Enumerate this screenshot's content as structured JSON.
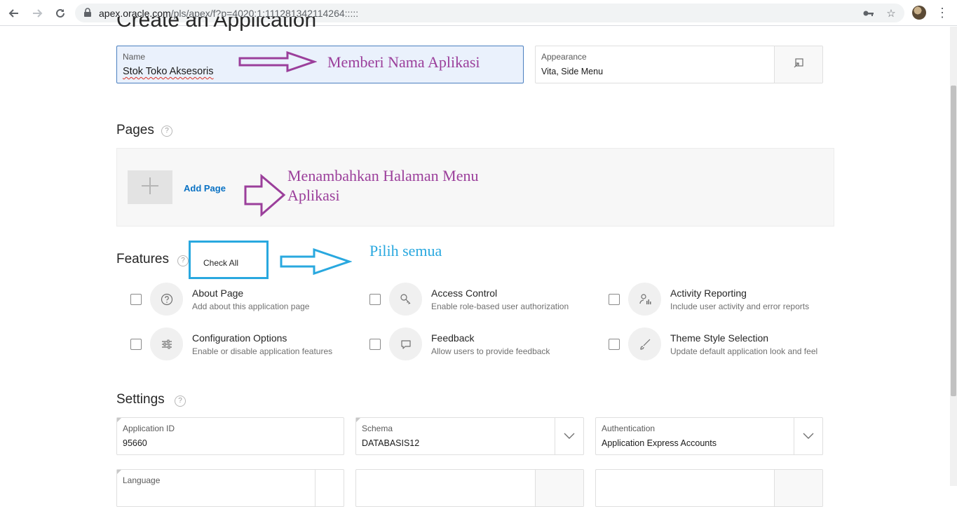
{
  "browser": {
    "url_host": "apex.oracle.com",
    "url_path": "/pls/apex/f?p=4020:1:111281342114264:::::"
  },
  "page": {
    "title": "Create an Application"
  },
  "name_field": {
    "label": "Name",
    "value": "Stok Toko Aksesoris"
  },
  "appearance_field": {
    "label": "Appearance",
    "value": "Vita, Side Menu"
  },
  "pages": {
    "title": "Pages",
    "add_page": "Add Page"
  },
  "features": {
    "title": "Features",
    "check_all": "Check All",
    "items": [
      {
        "title": "About Page",
        "desc": "Add about this application page",
        "icon": "question-circle-icon"
      },
      {
        "title": "Access Control",
        "desc": "Enable role-based user authorization",
        "icon": "key-icon"
      },
      {
        "title": "Activity Reporting",
        "desc": "Include user activity and error reports",
        "icon": "user-chart-icon"
      },
      {
        "title": "Configuration Options",
        "desc": "Enable or disable application features",
        "icon": "sliders-icon"
      },
      {
        "title": "Feedback",
        "desc": "Allow users to provide feedback",
        "icon": "comment-icon"
      },
      {
        "title": "Theme Style Selection",
        "desc": "Update default application look and feel",
        "icon": "brush-icon"
      }
    ]
  },
  "settings": {
    "title": "Settings",
    "application_id": {
      "label": "Application ID",
      "value": "95660"
    },
    "schema": {
      "label": "Schema",
      "value": "DATABASIS12"
    },
    "authentication": {
      "label": "Authentication",
      "value": "Application Express Accounts"
    },
    "language": {
      "label": "Language"
    }
  },
  "annotations": {
    "name": "Memberi Nama Aplikasi",
    "pages_line1": "Menambahkan Halaman Menu",
    "pages_line2": "Aplikasi",
    "features": "Pilih semua"
  },
  "colors": {
    "annotation_purple": "#9b3f9b",
    "annotation_blue": "#29a8df",
    "link_blue": "#0a72c4",
    "focus_blue": "#4a7fc0"
  }
}
